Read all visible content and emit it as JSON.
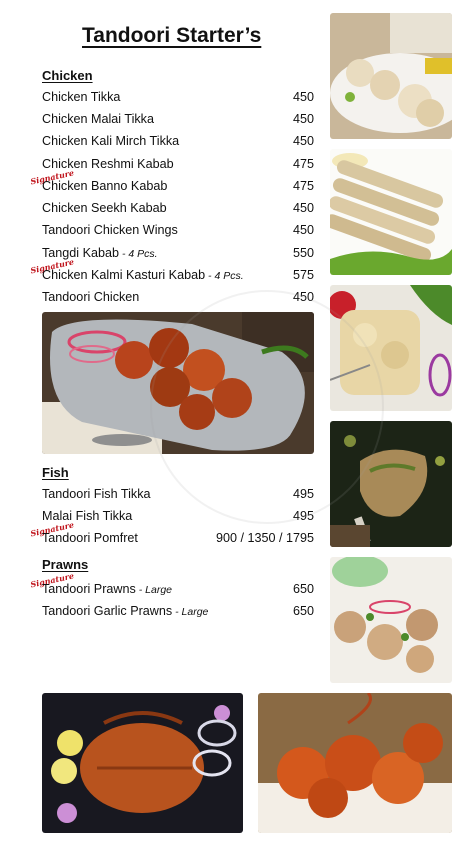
{
  "title": "Tandoori Starter’s",
  "signature_label": "Signature",
  "sections": {
    "chicken": {
      "heading": "Chicken",
      "items": [
        {
          "name": "Chicken Tikka",
          "note": "",
          "price": "450",
          "signature": false
        },
        {
          "name": "Chicken Malai Tikka",
          "note": "",
          "price": "450",
          "signature": false
        },
        {
          "name": "Chicken Kali Mirch Tikka",
          "note": "",
          "price": "450",
          "signature": false
        },
        {
          "name": "Chicken Reshmi Kabab",
          "note": "",
          "price": "475",
          "signature": false
        },
        {
          "name": "Chicken Banno Kabab",
          "note": "",
          "price": "475",
          "signature": true
        },
        {
          "name": "Chicken Seekh Kabab",
          "note": "",
          "price": "450",
          "signature": false
        },
        {
          "name": "Tandoori Chicken Wings",
          "note": "",
          "price": "450",
          "signature": false
        },
        {
          "name": "Tangdi Kabab",
          "note": " - 4 Pcs.",
          "price": "550",
          "signature": false
        },
        {
          "name": "Chicken Kalmi Kasturi Kabab",
          "note": " - 4 Pcs.",
          "price": "575",
          "signature": true
        },
        {
          "name": "Tandoori Chicken",
          "note": "",
          "price": "450",
          "signature": false
        }
      ]
    },
    "fish": {
      "heading": "Fish",
      "items": [
        {
          "name": "Tandoori Fish Tikka",
          "note": "",
          "price": "495",
          "signature": false
        },
        {
          "name": "Malai  Fish Tikka",
          "note": "",
          "price": "495",
          "signature": false
        },
        {
          "name": "Tandoori Pomfret",
          "note": "",
          "price": "900  /  1350  /  1795",
          "signature": true
        }
      ]
    },
    "prawns": {
      "heading": "Prawns",
      "items": [
        {
          "name": "Tandoori Prawns",
          "note": " - Large",
          "price": "650",
          "signature": true
        },
        {
          "name": "Tandoori Garlic Prawns",
          "note": " - Large",
          "price": "650",
          "signature": false
        }
      ]
    }
  },
  "photos": [
    {
      "id": "malai-tikka-photo",
      "plate": "#f4f2ee",
      "food": "#e9dcc0",
      "accent": "#7fb23a"
    },
    {
      "id": "seekh-kabab-photo",
      "plate": "#fbfbf8",
      "food": "#d8c7a0",
      "accent": "#6aa82e"
    },
    {
      "id": "reshmi-kabab-photo",
      "plate": "#eae7df",
      "food": "#e8d6a6",
      "accent": "#c8202a"
    },
    {
      "id": "tandoori-chicken-leg-photo",
      "plate": "#1c2416",
      "food": "#a88a58",
      "accent": "#7e8c3a"
    },
    {
      "id": "chicken-tikka-platter-photo",
      "plate": "#b0b4b8",
      "food": "#b8441c",
      "accent": "#d9446a"
    },
    {
      "id": "kalmi-kabab-photo",
      "plate": "#f2efe9",
      "food": "#c9a27a",
      "accent": "#9fd29a"
    },
    {
      "id": "tandoori-pomfret-photo",
      "plate": "#181820",
      "food": "#b8531e",
      "accent": "#efe26a"
    },
    {
      "id": "tandoori-prawns-photo",
      "plate": "#f3eee6",
      "food": "#d4581c",
      "accent": "#8a6a44"
    }
  ]
}
